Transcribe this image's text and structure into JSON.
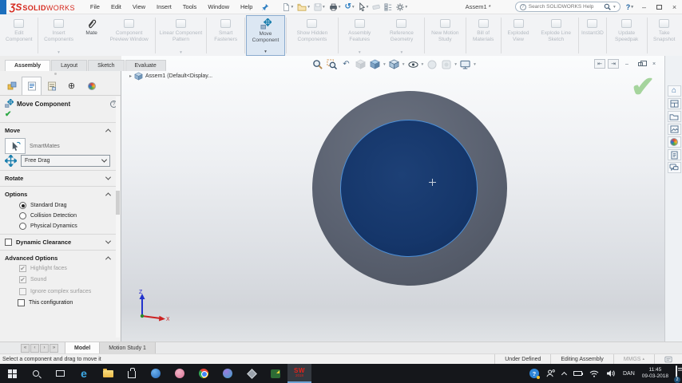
{
  "titlebar": {
    "logo_mark": "ƷS",
    "logo_solid": "SOLID",
    "logo_works": "WORKS",
    "menus": [
      "File",
      "Edit",
      "View",
      "Insert",
      "Tools",
      "Window",
      "Help"
    ],
    "document_title": "Assem1 *",
    "search_placeholder": "Search SOLIDWORKS Help",
    "help_label": "?"
  },
  "ribbon": {
    "tabs": [
      {
        "label": "Assembly"
      },
      {
        "label": "Layout"
      },
      {
        "label": "Sketch"
      },
      {
        "label": "Evaluate"
      }
    ],
    "buttons": [
      {
        "label": "Edit Component"
      },
      {
        "label": "Insert Components"
      },
      {
        "label": "Mate"
      },
      {
        "label": "Component Preview Window"
      },
      {
        "label": "Linear Component Pattern"
      },
      {
        "label": "Smart Fasteners"
      },
      {
        "label": "Move Component"
      },
      {
        "label": "Show Hidden Components"
      },
      {
        "label": "Assembly Features"
      },
      {
        "label": "Reference Geometry"
      },
      {
        "label": "New Motion Study"
      },
      {
        "label": "Bill of Materials"
      },
      {
        "label": "Exploded View"
      },
      {
        "label": "Explode Line Sketch"
      },
      {
        "label": "Instant3D"
      },
      {
        "label": "Update Speedpak"
      },
      {
        "label": "Take Snapshot"
      }
    ]
  },
  "feature_tree": {
    "root": "Assem1  (Default<Display..."
  },
  "panel": {
    "title": "Move Component",
    "move_header": "Move",
    "smartmates": "SmartMates",
    "drag_mode": "Free Drag",
    "rotate_header": "Rotate",
    "options_header": "Options",
    "radio_standard": "Standard Drag",
    "radio_collision": "Collision Detection",
    "radio_physical": "Physical Dynamics",
    "dynamic_clearance": "Dynamic Clearance",
    "advanced_header": "Advanced Options",
    "check_highlight": "Highlight faces",
    "check_sound": "Sound",
    "check_ignore": "Ignore complex surfaces",
    "check_config": "This configuration"
  },
  "bottom": {
    "model_tab": "Model",
    "motion_tab": "Motion Study 1",
    "status_left": "Select a component and drag to move it",
    "under_defined": "Under Defined",
    "editing": "Editing Assembly",
    "units": "MMGS"
  },
  "taskbar": {
    "language": "DAN",
    "time": "11:45",
    "date": "09-03-2018",
    "notification_count": "2",
    "sw_badge": "SW",
    "sw_year": "2018"
  },
  "glyphs": {
    "dropdown": "▾",
    "check": "✔",
    "ok_check": "✔",
    "tree_arrow": "▸",
    "nav_first": "«",
    "nav_prev": "‹",
    "nav_next": "›",
    "nav_last": "»",
    "target": "⊕",
    "undo": "↺",
    "prev_view": "↶",
    "home": "⌂",
    "minimize": "–",
    "close": "×",
    "pane_left": "⇤",
    "pane_right": "⇥",
    "mmgs_arrow": "▴"
  },
  "colors": {
    "logo_red": "#d6291e",
    "accent_blue": "#2e7fc2",
    "selected_bg": "#dce7f3",
    "ring_gray": "#596070",
    "part_blue": "#16386d",
    "part_edge": "#4d8fd6",
    "confirm_green": "#9fd49a"
  }
}
